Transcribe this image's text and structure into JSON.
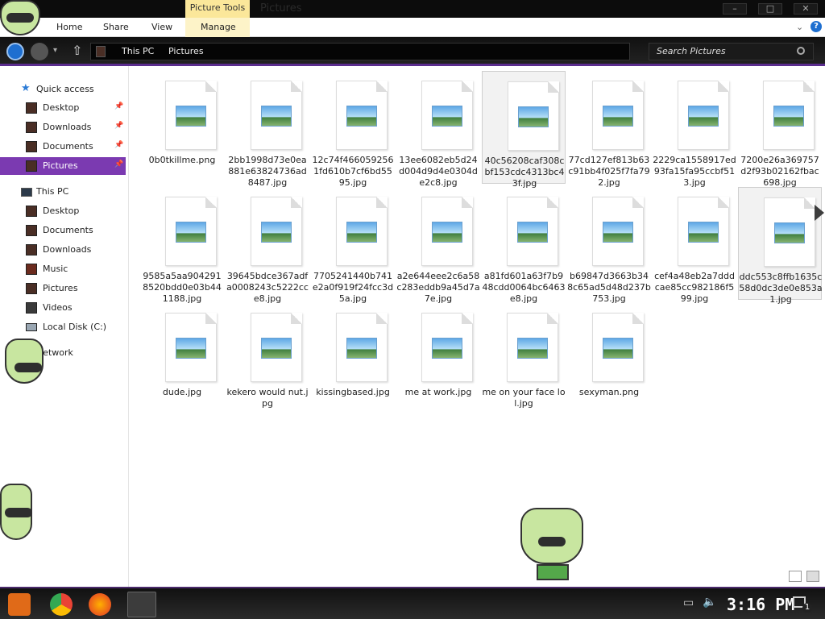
{
  "window": {
    "title": "Pictures",
    "context_tab": "Picture Tools",
    "controls": {
      "minimize": "–",
      "maximize": "□",
      "close": "✕"
    }
  },
  "ribbon": {
    "tabs": [
      "Home",
      "Share",
      "View",
      "Manage"
    ],
    "help": "?"
  },
  "address": {
    "crumbs": [
      "This PC",
      "Pictures"
    ],
    "search_placeholder": "Search Pictures"
  },
  "sidebar": {
    "quick_access": {
      "label": "Quick access",
      "items": [
        "Desktop",
        "Downloads",
        "Documents",
        "Pictures"
      ],
      "selected": "Pictures"
    },
    "this_pc": {
      "label": "This PC",
      "items": [
        "Desktop",
        "Documents",
        "Downloads",
        "Music",
        "Pictures",
        "Videos",
        "Local Disk (C:)"
      ]
    },
    "network": {
      "label": "Network"
    }
  },
  "files": [
    {
      "name": "0b0tkillme.png"
    },
    {
      "name": "2bb1998d73e0ea881e63824736ad8487.jpg"
    },
    {
      "name": "12c74f4660592561fd610b7cf6bd5595.jpg"
    },
    {
      "name": "13ee6082eb5d24d004d9d4e0304de2c8.jpg"
    },
    {
      "name": "40c56208caf308cbf153cdc4313bc43f.jpg"
    },
    {
      "name": "77cd127ef813b63c91bb4f025f7fa792.jpg"
    },
    {
      "name": "2229ca1558917ed93fa15fa95ccbf513.jpg"
    },
    {
      "name": "7200e26a369757d2f93b02162fbac698.jpg"
    },
    {
      "name": "9585a5aa9042918520bdd0e03b441188.jpg"
    },
    {
      "name": "39645bdce367adfa0008243c5222cce8.jpg"
    },
    {
      "name": "7705241440b741e2a0f919f24fcc3d5a.jpg"
    },
    {
      "name": "a2e644eee2c6a58c283eddb9a45d7a7e.jpg"
    },
    {
      "name": "a81fd601a63f7b948cdd0064bc6463e8.jpg"
    },
    {
      "name": "b69847d3663b348c65ad5d48d237b753.jpg"
    },
    {
      "name": "cef4a48eb2a7dddcae85cc982186f599.jpg"
    },
    {
      "name": "ddc553c8ffb1635c58d0dc3de0e853a1.jpg"
    },
    {
      "name": "dude.jpg"
    },
    {
      "name": "kekero would nut.jpg"
    },
    {
      "name": "kissingbased.jpg"
    },
    {
      "name": "me at work.jpg"
    },
    {
      "name": "me on your face lol.jpg"
    },
    {
      "name": "sexyman.png"
    }
  ],
  "taskbar": {
    "clock": "3:16 PM",
    "notification_count": "1",
    "accent": "#7b3ab1"
  }
}
